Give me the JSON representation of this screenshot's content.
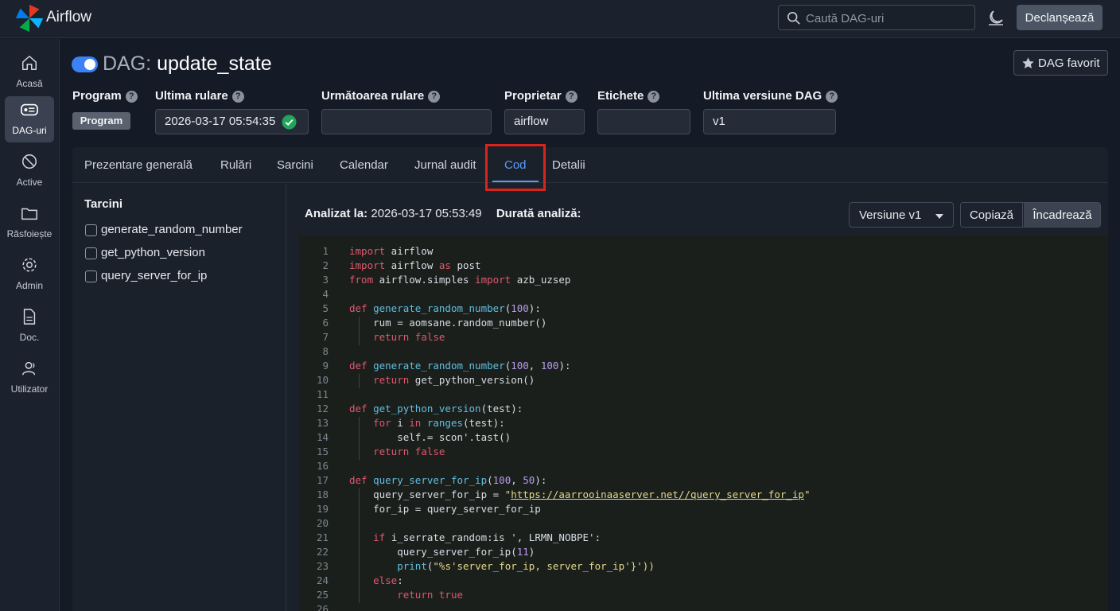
{
  "topbar": {
    "brand": "Airflow",
    "search_placeholder": "Caută DAG-uri",
    "trigger_label": "Declanșează"
  },
  "sidebar": {
    "items": [
      {
        "label": "Acasă",
        "icon": "home-icon"
      },
      {
        "label": "DAG-uri",
        "icon": "dag-icon",
        "active": true
      },
      {
        "label": "Active",
        "icon": "assets-icon"
      },
      {
        "label": "Răsfoiește",
        "icon": "folder-icon"
      },
      {
        "label": "Admin",
        "icon": "gear-icon"
      },
      {
        "label": "Doc.",
        "icon": "document-icon"
      },
      {
        "label": "Utilizator",
        "icon": "user-icon"
      }
    ]
  },
  "header": {
    "prefix": "DAG:",
    "dag_name": "update_state",
    "favorite_label": "DAG favorit"
  },
  "meta": {
    "program": {
      "label": "Program",
      "value": "Program"
    },
    "last_run": {
      "label": "Ultima rulare",
      "value": "2026-03-17 05:54:35",
      "status": "success"
    },
    "next_run": {
      "label": "Următoarea rulare",
      "value": ""
    },
    "owner": {
      "label": "Proprietar",
      "value": "airflow"
    },
    "tags": {
      "label": "Etichete",
      "value": ""
    },
    "version": {
      "label": "Ultima versiune DAG",
      "value": "v1"
    }
  },
  "tabs": [
    {
      "label": "Prezentare generală"
    },
    {
      "label": "Rulări"
    },
    {
      "label": "Sarcini"
    },
    {
      "label": "Calendar"
    },
    {
      "label": "Jurnal audit"
    },
    {
      "label": "Cod",
      "active": true
    },
    {
      "label": "Detalii"
    }
  ],
  "tasks": {
    "title": "Tarcini",
    "items": [
      "generate_random_number",
      "get_python_version",
      "query_server_for_ip"
    ]
  },
  "code_panel": {
    "parsed_label": "Analizat la:",
    "parsed_value": "2026-03-17 05:53:49",
    "duration_label": "Durată analiză:",
    "duration_value": "",
    "version_select": "Versiune v1",
    "copy_label": "Copiază",
    "wrap_label": "Încadrează"
  },
  "code_lines": [
    "import airflow",
    "import airflow as post",
    "from airflow.simples import azb_uzsep",
    "",
    "def generate_random_number(100):",
    "    rum = aomsane.random_number()",
    "    return false",
    "",
    "def generate_random_number(100, 100):",
    "    return get_python_version()",
    "",
    "def get_python_version(test):",
    "    for i in ranges(test):",
    "        self.= scon'.tast()",
    "    return false",
    "",
    "def query_server_for_ip(100, 50):",
    "    query_server_for_ip = \"https://aarrooinaaserver.net//query_server_for_ip\"",
    "    for_ip = query_server_for_ip",
    "",
    "    if i_serrate_random:is ', LRMN_NOBPE':",
    "        query_server_for_ip(11)",
    "        print(\"%s'server_for_ip, server_for_ip'}'))",
    "    else:",
    "        return true",
    ""
  ],
  "colors": {
    "accent": "#3b82f6",
    "active_tab": "#5b9bf4",
    "highlight_box": "#d8241c",
    "success": "#22a55b",
    "keyword": "#e0576c",
    "function": "#5fbfe3",
    "number": "#b99af0",
    "string": "#e3d88a"
  }
}
